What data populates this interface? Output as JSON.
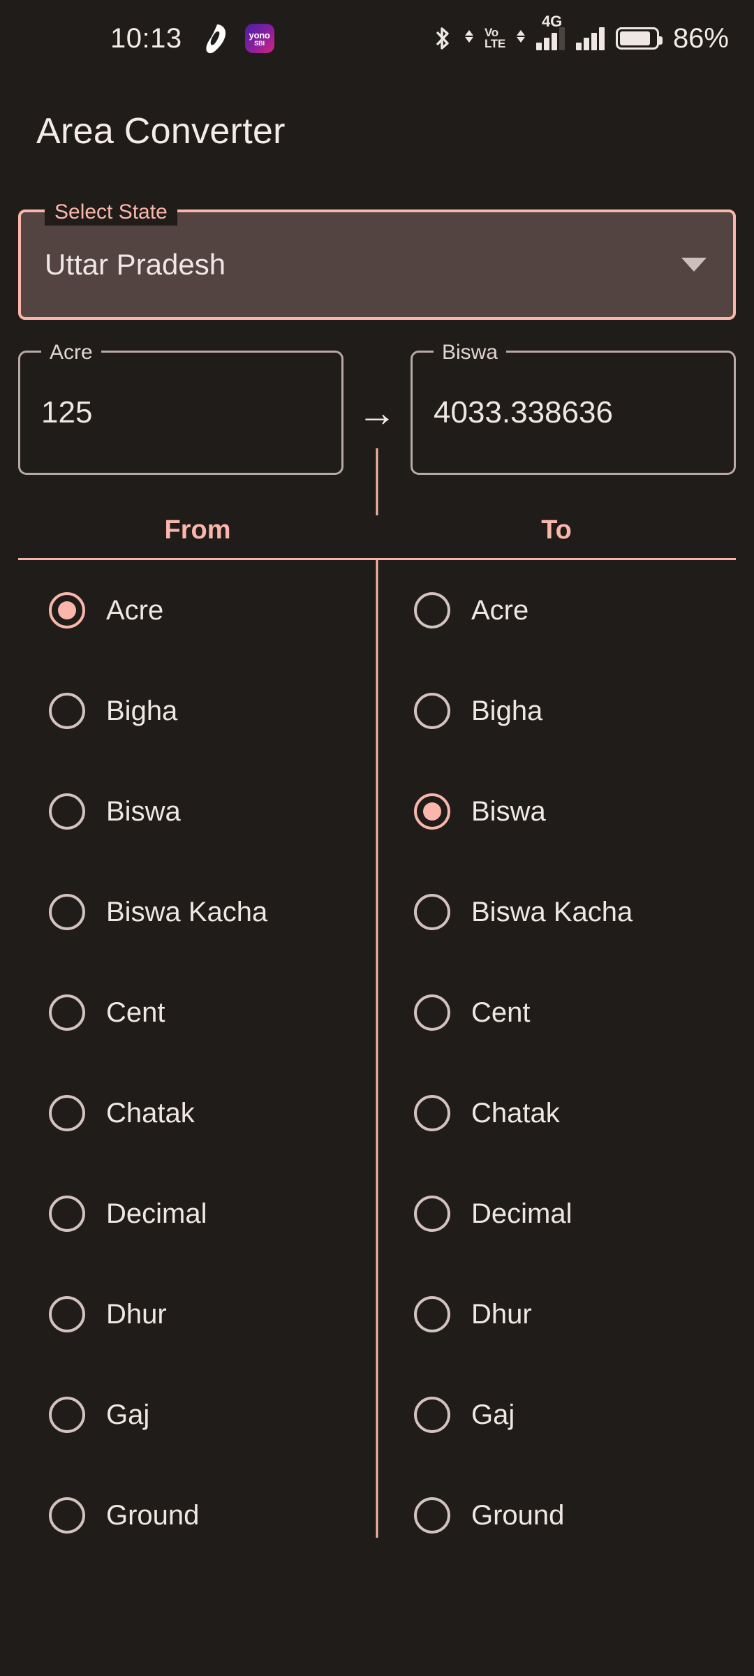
{
  "status_bar": {
    "time": "10:13",
    "battery_percent": "86%",
    "volte_line1": "Vo",
    "volte_line2": "LTE",
    "network_type": "4G",
    "yono_line1": "yono",
    "yono_line2": "SBI",
    "icons": [
      "airtel-icon",
      "yono-sbi-icon",
      "bluetooth-icon",
      "volte-icon",
      "signal-bars-icon",
      "signal-bars-2-icon",
      "battery-icon"
    ]
  },
  "header": {
    "title": "Area Converter"
  },
  "state_select": {
    "label": "Select State",
    "value": "Uttar Pradesh",
    "caret": "chevron-down-icon"
  },
  "conversion": {
    "from": {
      "label": "Acre",
      "value": "125"
    },
    "arrow": "→",
    "to": {
      "label": "Biswa",
      "value": "4033.338636"
    }
  },
  "units_table": {
    "headers": {
      "from": "From",
      "to": "To"
    },
    "selected_from": "Acre",
    "selected_to": "Biswa",
    "rows": [
      "Acre",
      "Bigha",
      "Biswa",
      "Biswa Kacha",
      "Cent",
      "Chatak",
      "Decimal",
      "Dhur",
      "Gaj",
      "Ground"
    ]
  },
  "colors": {
    "background": "#201c1a",
    "accent": "#fab6ab",
    "text": "#efe7e3",
    "field_border": "#b9a9a5",
    "select_fill": "#534441"
  }
}
